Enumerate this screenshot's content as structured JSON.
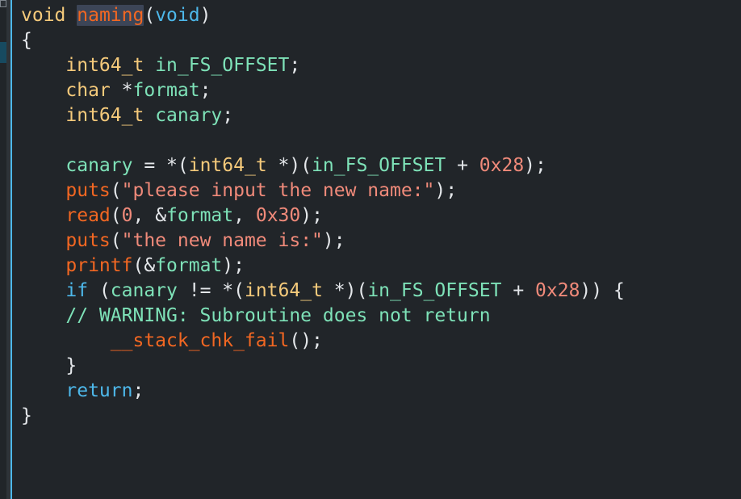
{
  "view": {
    "title": "Decompiler",
    "background_color": "#212529",
    "gutter_color": "#2e3338",
    "caret_line_color": "#4db8ea",
    "marker_color": "#174a60",
    "selection_color": "#3c4557"
  },
  "palette": {
    "type": "#f5ca7b",
    "identifier": "#7ee2b8",
    "function": "#f26722",
    "keyword": "#4db8ea",
    "string": "#f08a7a",
    "number": "#f08a7a",
    "punctuation": "#e4e7ea",
    "comment": "#7ee2b8"
  },
  "gutter": {
    "scroll_thumb_name": "scrollbar-thumb",
    "marker_name": "line-marker"
  },
  "code": {
    "language": "c",
    "function_name": "naming",
    "plain_text": "void naming(void)\n{\n    int64_t in_FS_OFFSET;\n    char *format;\n    int64_t canary;\n\n    canary = *(int64_t *)(in_FS_OFFSET + 0x28);\n    puts(\"please input the new name:\");\n    read(0, &format, 0x30);\n    puts(\"the new name is:\");\n    printf(&format);\n    if (canary != *(int64_t *)(in_FS_OFFSET + 0x28)) {\n    // WARNING: Subroutine does not return\n        __stack_chk_fail();\n    }\n    return;\n}",
    "lines": [
      {
        "id": "line-1",
        "tokens": [
          {
            "text": "void",
            "kind": "type"
          },
          {
            "text": " ",
            "kind": "punct"
          },
          {
            "text": "naming",
            "kind": "func",
            "selected": true
          },
          {
            "text": "(",
            "kind": "punct"
          },
          {
            "text": "void",
            "kind": "kw"
          },
          {
            "text": ")",
            "kind": "punct"
          }
        ]
      },
      {
        "id": "line-2",
        "tokens": [
          {
            "text": "{",
            "kind": "punct"
          }
        ]
      },
      {
        "id": "line-3",
        "tokens": [
          {
            "text": "    ",
            "kind": "punct"
          },
          {
            "text": "int64_t",
            "kind": "type"
          },
          {
            "text": " ",
            "kind": "punct"
          },
          {
            "text": "in_FS_OFFSET",
            "kind": "ident"
          },
          {
            "text": ";",
            "kind": "punct"
          }
        ]
      },
      {
        "id": "line-4",
        "tokens": [
          {
            "text": "    ",
            "kind": "punct"
          },
          {
            "text": "char",
            "kind": "type"
          },
          {
            "text": " *",
            "kind": "punct"
          },
          {
            "text": "format",
            "kind": "ident"
          },
          {
            "text": ";",
            "kind": "punct"
          }
        ]
      },
      {
        "id": "line-5",
        "tokens": [
          {
            "text": "    ",
            "kind": "punct"
          },
          {
            "text": "int64_t",
            "kind": "type"
          },
          {
            "text": " ",
            "kind": "punct"
          },
          {
            "text": "canary",
            "kind": "ident"
          },
          {
            "text": ";",
            "kind": "punct"
          }
        ]
      },
      {
        "id": "line-6",
        "tokens": []
      },
      {
        "id": "line-7",
        "tokens": [
          {
            "text": "    ",
            "kind": "punct"
          },
          {
            "text": "canary",
            "kind": "ident"
          },
          {
            "text": " = *(",
            "kind": "punct"
          },
          {
            "text": "int64_t",
            "kind": "type"
          },
          {
            "text": " *)(",
            "kind": "punct"
          },
          {
            "text": "in_FS_OFFSET",
            "kind": "ident"
          },
          {
            "text": " + ",
            "kind": "punct"
          },
          {
            "text": "0x28",
            "kind": "num"
          },
          {
            "text": ");",
            "kind": "punct"
          }
        ]
      },
      {
        "id": "line-8",
        "tokens": [
          {
            "text": "    ",
            "kind": "punct"
          },
          {
            "text": "puts",
            "kind": "func"
          },
          {
            "text": "(",
            "kind": "punct"
          },
          {
            "text": "\"please input the new name:\"",
            "kind": "str"
          },
          {
            "text": ");",
            "kind": "punct"
          }
        ]
      },
      {
        "id": "line-9",
        "tokens": [
          {
            "text": "    ",
            "kind": "punct"
          },
          {
            "text": "read",
            "kind": "func"
          },
          {
            "text": "(",
            "kind": "punct"
          },
          {
            "text": "0",
            "kind": "num"
          },
          {
            "text": ", &",
            "kind": "punct"
          },
          {
            "text": "format",
            "kind": "ident"
          },
          {
            "text": ", ",
            "kind": "punct"
          },
          {
            "text": "0x30",
            "kind": "num"
          },
          {
            "text": ");",
            "kind": "punct"
          }
        ]
      },
      {
        "id": "line-10",
        "tokens": [
          {
            "text": "    ",
            "kind": "punct"
          },
          {
            "text": "puts",
            "kind": "func"
          },
          {
            "text": "(",
            "kind": "punct"
          },
          {
            "text": "\"the new name is:\"",
            "kind": "str"
          },
          {
            "text": ");",
            "kind": "punct"
          }
        ]
      },
      {
        "id": "line-11",
        "tokens": [
          {
            "text": "    ",
            "kind": "punct"
          },
          {
            "text": "printf",
            "kind": "func"
          },
          {
            "text": "(&",
            "kind": "punct"
          },
          {
            "text": "format",
            "kind": "ident"
          },
          {
            "text": ");",
            "kind": "punct"
          }
        ]
      },
      {
        "id": "line-12",
        "tokens": [
          {
            "text": "    ",
            "kind": "punct"
          },
          {
            "text": "if",
            "kind": "kw"
          },
          {
            "text": " (",
            "kind": "punct"
          },
          {
            "text": "canary",
            "kind": "ident"
          },
          {
            "text": " != *(",
            "kind": "punct"
          },
          {
            "text": "int64_t",
            "kind": "type"
          },
          {
            "text": " *)(",
            "kind": "punct"
          },
          {
            "text": "in_FS_OFFSET",
            "kind": "ident"
          },
          {
            "text": " + ",
            "kind": "punct"
          },
          {
            "text": "0x28",
            "kind": "num"
          },
          {
            "text": ")) {",
            "kind": "punct"
          }
        ]
      },
      {
        "id": "line-13",
        "tokens": [
          {
            "text": "    ",
            "kind": "punct"
          },
          {
            "text": "// WARNING: Subroutine does not return",
            "kind": "comment"
          }
        ]
      },
      {
        "id": "line-14",
        "tokens": [
          {
            "text": "        ",
            "kind": "punct"
          },
          {
            "text": "__stack_chk_fail",
            "kind": "func"
          },
          {
            "text": "();",
            "kind": "punct"
          }
        ]
      },
      {
        "id": "line-15",
        "tokens": [
          {
            "text": "    ",
            "kind": "punct"
          },
          {
            "text": "}",
            "kind": "punct"
          }
        ]
      },
      {
        "id": "line-16",
        "tokens": [
          {
            "text": "    ",
            "kind": "punct"
          },
          {
            "text": "return",
            "kind": "kw"
          },
          {
            "text": ";",
            "kind": "punct"
          }
        ]
      },
      {
        "id": "line-17",
        "tokens": [
          {
            "text": "}",
            "kind": "punct"
          }
        ]
      }
    ]
  }
}
